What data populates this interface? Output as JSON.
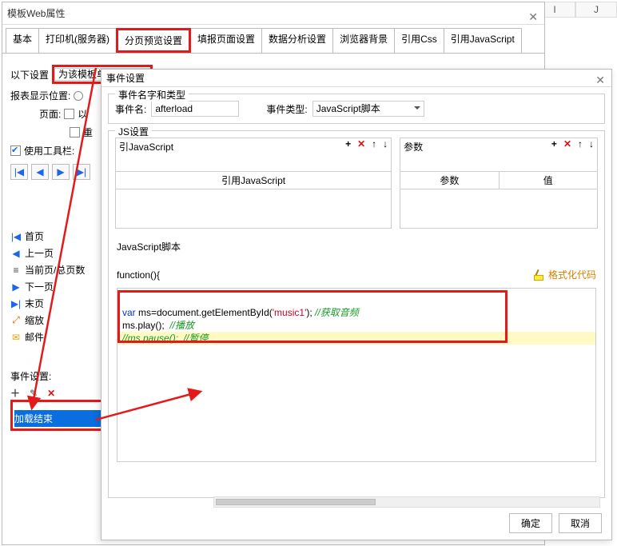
{
  "sheet_headers": [
    "I",
    "J"
  ],
  "dialog1": {
    "title": "模板Web属性",
    "tabs": [
      "基本",
      "打印机(服务器)",
      "分页预览设置",
      "填报页面设置",
      "数据分析设置",
      "浏览器背景",
      "引用Css",
      "引用JavaScript"
    ],
    "active_tab_index": 2,
    "setting_label": "以下设置",
    "setting_dropdown": "为该模板单独设置",
    "report_pos_label": "报表显示位置:",
    "page_label": "页面:",
    "ck_option1": "以",
    "ck_option2": "重",
    "toolbar_label": "使用工具栏:",
    "tb_glyphs": [
      "|◀",
      "◀",
      "▶",
      "▶|"
    ],
    "nav_items": [
      {
        "icon": "|◀",
        "label": "首页",
        "color": "#1e66e8"
      },
      {
        "icon": "◀",
        "label": "上一页",
        "color": "#1e66e8"
      },
      {
        "icon": "≡",
        "label": "当前页/总页数",
        "color": "#444"
      },
      {
        "icon": "▶",
        "label": "下一页",
        "color": "#1e66e8"
      },
      {
        "icon": "▶|",
        "label": "末页",
        "color": "#1e66e8"
      },
      {
        "icon": "⤢",
        "label": "缩放",
        "color": "#d36b00"
      },
      {
        "icon": "✉",
        "label": "邮件",
        "color": "#e0a400"
      }
    ],
    "event_setting_label": "事件设置:",
    "event_item": "加载结束"
  },
  "dialog2": {
    "title": "事件设置",
    "group1_legend": "事件名字和类型",
    "name_label": "事件名:",
    "name_value": "afterload",
    "type_label": "事件类型:",
    "type_value": "JavaScript脚本",
    "group2_legend": "JS设置",
    "js_ref_label": "引JavaScript",
    "js_ref_header": "引用JavaScript",
    "param_label": "参数",
    "param_header": "参数",
    "value_header": "值",
    "script_type_label": "JavaScript脚本",
    "func_label": "function(){",
    "format_label": "格式化代码",
    "ok_label": "确定",
    "cancel_label": "取消"
  },
  "code": {
    "line1a": "var",
    "line1b": " ms=document.getElementById(",
    "line1c": "'music1'",
    "line1d": "); ",
    "line1e": "//获取音频",
    "line2a": "ms.play();  ",
    "line2b": "//播放",
    "line3": "//ms.pause();  //暂停"
  }
}
